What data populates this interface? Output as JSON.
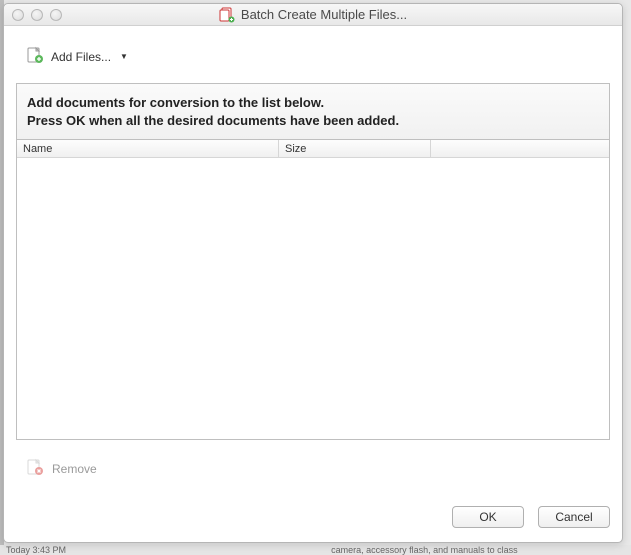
{
  "window": {
    "title": "Batch Create Multiple Files..."
  },
  "toolbar": {
    "add_files_label": "Add Files..."
  },
  "instructions": {
    "line1": "Add documents for conversion to the list below.",
    "line2": "Press OK when all the desired documents have been added."
  },
  "columns": {
    "name": "Name",
    "size": "Size"
  },
  "remove": {
    "label": "Remove"
  },
  "footer": {
    "ok": "OK",
    "cancel": "Cancel"
  },
  "background": {
    "bottom_left": "Today   3:43 PM",
    "bottom_right": "camera, accessory flash, and manuals to class"
  }
}
